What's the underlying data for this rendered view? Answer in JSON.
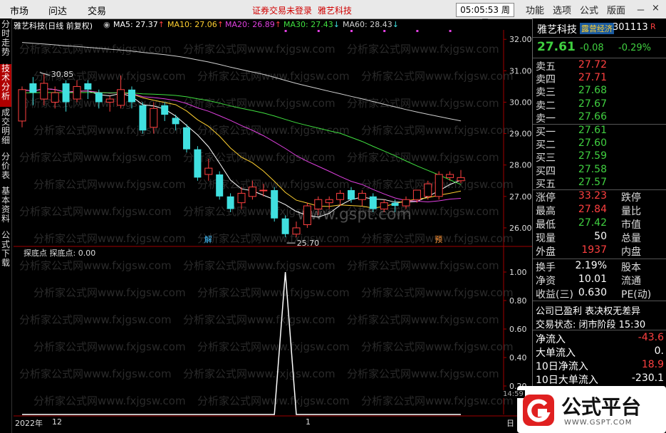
{
  "menu": {
    "items": [
      "市场",
      "问达",
      "交易"
    ],
    "notice": "证券交易未登录",
    "notice_stock": "雅艺科技",
    "clock": "05:05:53",
    "weekday": "周日",
    "right_items": [
      "功能",
      "选项",
      "公式",
      "版面"
    ],
    "win_controls": [
      "－",
      "×"
    ]
  },
  "left_tabs": [
    {
      "label": "分时走势",
      "active": false
    },
    {
      "label": "技术分析",
      "active": true
    },
    {
      "label": "成交明细",
      "active": false
    },
    {
      "label": "分价表",
      "active": false
    },
    {
      "label": "基本资料",
      "active": false
    },
    {
      "label": "公式下载",
      "active": false
    }
  ],
  "main_chart": {
    "title": "雅艺科技(日线 前复权)",
    "ma": [
      {
        "label": "MA5: 27.37",
        "color": "#ffffff",
        "arrow": "↑"
      },
      {
        "label": "MA10: 27.06",
        "color": "#ffd030",
        "arrow": "↑"
      },
      {
        "label": "MA20: 26.89",
        "color": "#e040e0",
        "arrow": "↑"
      },
      {
        "label": "MA30: 27.43",
        "color": "#40e040",
        "arrow": "↓"
      },
      {
        "label": "MA60: 28.43",
        "color": "#d0d0d0",
        "arrow": "↓"
      }
    ],
    "y_ticks": [
      "32.00",
      "31.00",
      "30.00",
      "29.00",
      "28.00",
      "27.00",
      "26.00"
    ],
    "high_label": "30.85",
    "low_label": "25.70",
    "marker_jie": "解",
    "marker_yu": "预",
    "watermark": "分析家公式网www.fxjgsw.com",
    "gspt": "www.gspt.com"
  },
  "indicator": {
    "title": "探底点",
    "value_label": "探底点: 0.00",
    "y_ticks": [
      "1.00",
      "0.80",
      "0.60",
      "0.40",
      "0.20"
    ]
  },
  "x_axis": {
    "year": "2022年",
    "month": "12",
    "mid": "1",
    "period": "日"
  },
  "chart_data": {
    "type": "candlestick",
    "title": "雅艺科技(日线 前复权)",
    "ylim": [
      25.5,
      32.3
    ],
    "candles": [
      {
        "o": 29.4,
        "c": 30.4,
        "h": 30.5,
        "l": 29.2
      },
      {
        "o": 30.6,
        "c": 30.3,
        "h": 30.8,
        "l": 29.9
      },
      {
        "o": 30.1,
        "c": 30.6,
        "h": 30.9,
        "l": 29.9
      },
      {
        "o": 30.0,
        "c": 30.3,
        "h": 30.5,
        "l": 29.8
      },
      {
        "o": 30.6,
        "c": 30.0,
        "h": 30.7,
        "l": 29.7
      },
      {
        "o": 30.1,
        "c": 30.5,
        "h": 30.7,
        "l": 30.0
      },
      {
        "o": 30.6,
        "c": 30.4,
        "h": 30.7,
        "l": 30.1
      },
      {
        "o": 30.3,
        "c": 30.0,
        "h": 30.4,
        "l": 29.8
      },
      {
        "o": 30.0,
        "c": 30.1,
        "h": 30.2,
        "l": 29.7
      },
      {
        "o": 29.9,
        "c": 30.4,
        "h": 30.85,
        "l": 29.8
      },
      {
        "o": 30.4,
        "c": 30.0,
        "h": 30.5,
        "l": 29.8
      },
      {
        "o": 29.9,
        "c": 29.1,
        "h": 30.0,
        "l": 29.0
      },
      {
        "o": 29.2,
        "c": 29.8,
        "h": 30.0,
        "l": 29.0
      },
      {
        "o": 29.9,
        "c": 29.6,
        "h": 30.0,
        "l": 29.4
      },
      {
        "o": 29.5,
        "c": 29.3,
        "h": 29.6,
        "l": 29.1
      },
      {
        "o": 29.2,
        "c": 28.5,
        "h": 29.3,
        "l": 28.4
      },
      {
        "o": 28.5,
        "c": 27.6,
        "h": 28.6,
        "l": 27.5
      },
      {
        "o": 27.7,
        "c": 27.9,
        "h": 28.2,
        "l": 27.5
      },
      {
        "o": 27.7,
        "c": 27.0,
        "h": 27.8,
        "l": 26.9
      },
      {
        "o": 27.0,
        "c": 26.6,
        "h": 27.1,
        "l": 26.5
      },
      {
        "o": 26.8,
        "c": 27.1,
        "h": 27.3,
        "l": 26.6
      },
      {
        "o": 27.0,
        "c": 27.3,
        "h": 27.5,
        "l": 26.9
      },
      {
        "o": 27.2,
        "c": 27.2,
        "h": 27.4,
        "l": 27.0
      },
      {
        "o": 27.2,
        "c": 26.3,
        "h": 27.3,
        "l": 26.2
      },
      {
        "o": 26.3,
        "c": 25.8,
        "h": 26.4,
        "l": 25.7
      },
      {
        "o": 25.8,
        "c": 26.0,
        "h": 26.2,
        "l": 25.7
      },
      {
        "o": 26.1,
        "c": 26.7,
        "h": 26.8,
        "l": 26.0
      },
      {
        "o": 26.6,
        "c": 26.9,
        "h": 27.0,
        "l": 26.4
      },
      {
        "o": 26.8,
        "c": 26.9,
        "h": 27.0,
        "l": 26.6
      },
      {
        "o": 26.9,
        "c": 27.1,
        "h": 27.2,
        "l": 26.7
      },
      {
        "o": 27.2,
        "c": 26.9,
        "h": 27.3,
        "l": 26.8
      },
      {
        "o": 26.9,
        "c": 27.1,
        "h": 27.2,
        "l": 26.7
      },
      {
        "o": 27.0,
        "c": 26.6,
        "h": 27.1,
        "l": 26.5
      },
      {
        "o": 26.6,
        "c": 26.8,
        "h": 26.9,
        "l": 26.5
      },
      {
        "o": 26.8,
        "c": 26.7,
        "h": 26.9,
        "l": 26.5
      },
      {
        "o": 26.7,
        "c": 26.9,
        "h": 27.0,
        "l": 26.6
      },
      {
        "o": 26.9,
        "c": 27.2,
        "h": 27.2,
        "l": 26.8
      },
      {
        "o": 27.0,
        "c": 27.4,
        "h": 27.5,
        "l": 26.9
      },
      {
        "o": 27.0,
        "c": 27.7,
        "h": 27.8,
        "l": 26.9
      },
      {
        "o": 27.6,
        "c": 27.7,
        "h": 27.8,
        "l": 27.5
      },
      {
        "o": 27.5,
        "c": 27.6,
        "h": 27.84,
        "l": 27.42
      }
    ],
    "indicator_values": [
      0,
      0,
      0,
      0,
      0,
      0,
      0,
      0,
      0,
      0,
      0,
      0,
      0,
      0,
      0,
      0,
      0,
      0,
      0,
      0,
      0,
      0,
      0,
      0,
      1,
      0,
      0,
      0,
      0,
      0,
      0,
      0,
      0,
      0,
      0,
      0,
      0,
      0,
      0,
      0,
      0
    ],
    "indicator_ylim": [
      0,
      1.1
    ]
  },
  "quote": {
    "name": "雅艺科技",
    "badge": "露营经济",
    "code": "301113",
    "code_tag": "R",
    "price": "27.61",
    "change": "-0.08",
    "pct": "-0.29%",
    "asks": [
      {
        "label": "卖五",
        "value": "27.72",
        "color": "red"
      },
      {
        "label": "卖四",
        "value": "27.71",
        "color": "red"
      },
      {
        "label": "卖三",
        "value": "27.68",
        "color": "green"
      },
      {
        "label": "卖二",
        "value": "27.67",
        "color": "green"
      },
      {
        "label": "卖一",
        "value": "27.66",
        "color": "green"
      }
    ],
    "bids": [
      {
        "label": "买一",
        "value": "27.61",
        "color": "green"
      },
      {
        "label": "买二",
        "value": "27.60",
        "color": "green"
      },
      {
        "label": "买三",
        "value": "27.59",
        "color": "green"
      },
      {
        "label": "买四",
        "value": "27.58",
        "color": "green"
      },
      {
        "label": "买五",
        "value": "27.57",
        "color": "green"
      }
    ],
    "stats": [
      {
        "label": "涨停",
        "value": "33.23",
        "color": "red",
        "label2": "跌停"
      },
      {
        "label": "最高",
        "value": "27.84",
        "color": "red",
        "label2": "量比"
      },
      {
        "label": "最低",
        "value": "27.42",
        "color": "green",
        "label2": "市值"
      },
      {
        "label": "现量",
        "value": "50",
        "color": "white",
        "label2": "总量"
      },
      {
        "label": "外盘",
        "value": "1937",
        "color": "red",
        "label2": "内盘"
      }
    ],
    "stats2": [
      {
        "label": "换手",
        "value": "2.19%",
        "label2": "股本"
      },
      {
        "label": "净资",
        "value": "10.01",
        "label2": "流通"
      },
      {
        "label": "收益(三)",
        "value": "0.630",
        "label2": "PE(动)"
      }
    ],
    "company_note": "公司已盈利 表决权无差异",
    "trade_status": "交易状态: 闭市阶段 15:30",
    "flows": [
      {
        "label": "净流入",
        "value": "-43.6",
        "color": "red"
      },
      {
        "label": "大单流入",
        "value": "0.",
        "color": "white"
      },
      {
        "label": "10日净流入",
        "value": "18.9",
        "color": "red"
      },
      {
        "label": "10日大单流入",
        "value": "-230.1",
        "color": "white"
      }
    ]
  },
  "footer": {
    "time": "14:59",
    "logo_text": "公式平台",
    "logo_url": "WWW.GSPT.COM"
  }
}
